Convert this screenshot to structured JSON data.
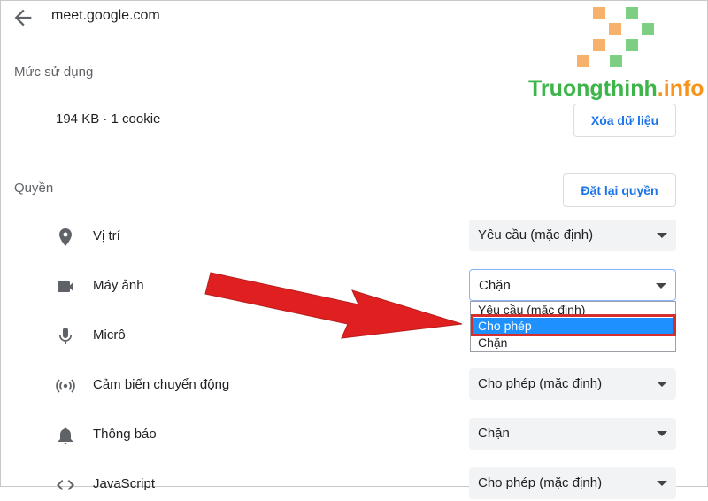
{
  "header": {
    "site": "meet.google.com"
  },
  "usage": {
    "heading": "Mức sử dụng",
    "summary": "194 KB · 1 cookie",
    "clear_button": "Xóa dữ liệu"
  },
  "permissions": {
    "heading": "Quyền",
    "reset_button": "Đặt lại quyền",
    "rows": [
      {
        "label": "Vị trí",
        "value": "Yêu cầu (mặc định)",
        "icon": "location-pin-icon"
      },
      {
        "label": "Máy ảnh",
        "value": "Chặn",
        "icon": "camera-icon"
      },
      {
        "label": "Micrô",
        "value": "",
        "icon": "microphone-icon"
      },
      {
        "label": "Cảm biến chuyển động",
        "value": "Cho phép (mặc định)",
        "icon": "motion-sensor-icon"
      },
      {
        "label": "Thông báo",
        "value": "Chặn",
        "icon": "bell-icon"
      },
      {
        "label": "JavaScript",
        "value": "Cho phép (mặc định)",
        "icon": "code-icon"
      }
    ]
  },
  "dropdown": {
    "options": [
      "Yêu cầu (mặc định)",
      "Cho phép",
      "Chặn"
    ],
    "highlighted": "Cho phép"
  },
  "watermark": {
    "brand": "Truongthinh",
    "suffix": ".info"
  },
  "colors": {
    "accent": "#1a73e8",
    "highlight": "#d32f2f",
    "arrow": "#e02020",
    "logo_green": "#3db54a",
    "logo_orange": "#f7941d"
  }
}
